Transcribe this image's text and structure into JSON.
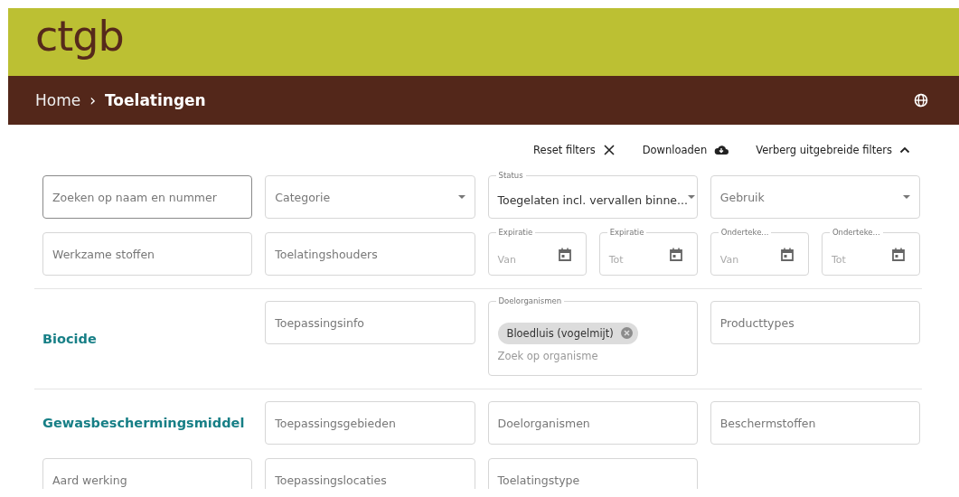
{
  "header": {
    "logo": "ctgb"
  },
  "breadcrumb": {
    "separator": "›",
    "items": [
      {
        "label": "Home",
        "current": false
      },
      {
        "label": "Toelatingen",
        "current": true
      }
    ]
  },
  "actions": [
    {
      "label": "Reset filters",
      "kind": "close"
    },
    {
      "label": "Downloaden",
      "kind": "cloud"
    },
    {
      "label": "Verberg uitgebreide filters",
      "kind": "chevron-up"
    }
  ],
  "filters": [
    {
      "kind": "text",
      "placeholder": "Zoeken op naam en nummer",
      "focused": true
    },
    {
      "kind": "select",
      "placeholder": "Categorie",
      "focused": false
    },
    {
      "kind": "select",
      "label": "Status",
      "value": "Toegelaten incl. vervallen binne...",
      "focused": false
    },
    {
      "kind": "select",
      "placeholder": "Gebruik",
      "focused": false
    },
    {
      "kind": "text",
      "placeholder": "Werkzame stoffen",
      "focused": false
    },
    {
      "kind": "text",
      "placeholder": "Toelatingshouders",
      "focused": false
    },
    {
      "kind": "date",
      "label": "Expiratie",
      "placeholder": "Van",
      "focused": false
    },
    {
      "kind": "date",
      "label": "Expiratie",
      "placeholder": "Tot",
      "focused": false
    },
    {
      "kind": "date",
      "label": "Onderteke...",
      "placeholder": "Van",
      "focused": false
    },
    {
      "kind": "date",
      "label": "Onderteke...",
      "placeholder": "Tot",
      "focused": false
    }
  ],
  "sections": [
    {
      "title": "Biocide",
      "fields": [
        {
          "kind": "text",
          "placeholder": "Toepassingsinfo",
          "focused": false
        },
        {
          "kind": "chips",
          "label": "Doelorganismen",
          "chips": [
            "Bloedluis (vogelmijt)"
          ],
          "placeholder": "Zoek op organisme",
          "focused": false
        },
        {
          "kind": "text",
          "placeholder": "Producttypes",
          "focused": false
        }
      ]
    },
    {
      "title": "Gewasbeschermingsmiddel",
      "fields": [
        {
          "kind": "text",
          "placeholder": "Toepassingsgebieden",
          "focused": false
        },
        {
          "kind": "text",
          "placeholder": "Doelorganismen",
          "focused": false
        },
        {
          "kind": "text",
          "placeholder": "Beschermstoffen",
          "focused": false
        },
        {
          "kind": "text",
          "placeholder": "Aard werking",
          "focused": false
        },
        {
          "kind": "text",
          "placeholder": "Toepassingslocaties",
          "focused": false
        },
        {
          "kind": "text",
          "placeholder": "Toelatingstype",
          "focused": false
        }
      ]
    }
  ]
}
